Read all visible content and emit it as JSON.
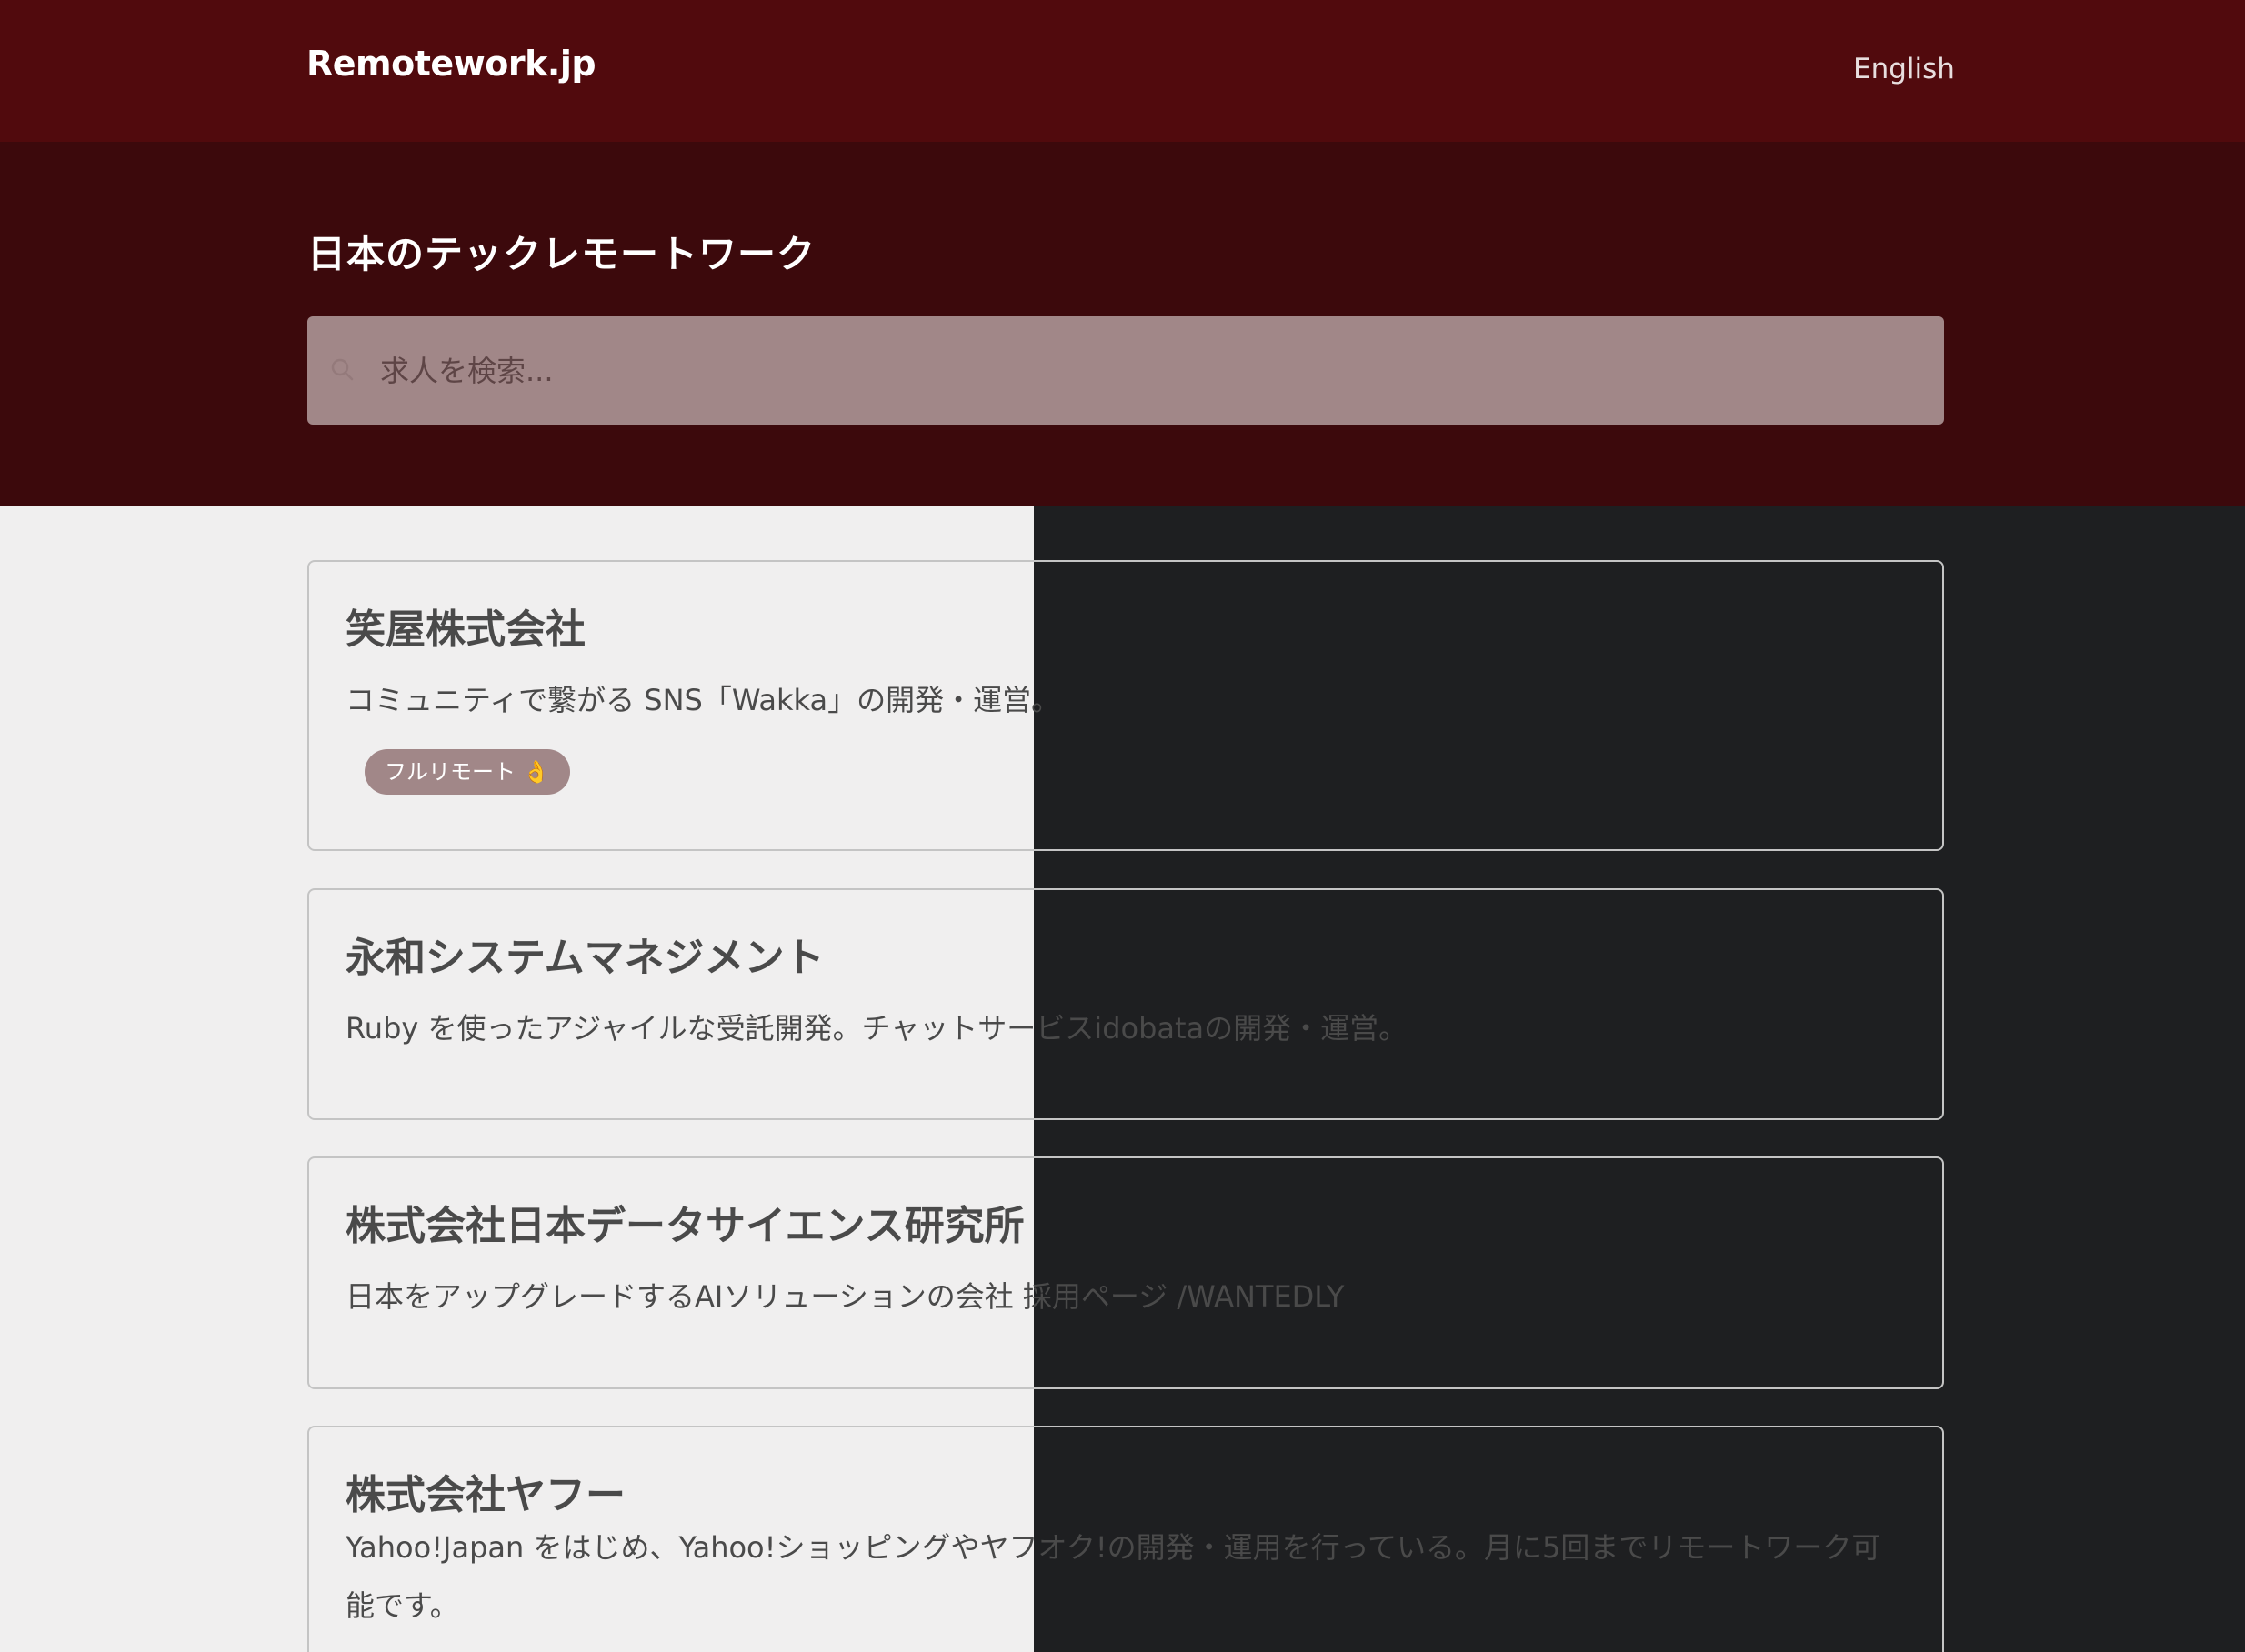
{
  "header": {
    "brand": "Remotework.jp",
    "language_link": "English"
  },
  "hero": {
    "title": "日本のテックレモートワーク",
    "search": {
      "placeholder": "求人を検索...",
      "icon": "search-icon"
    }
  },
  "jobs": [
    {
      "company": "笑屋株式会社",
      "description": "コミュニティで繋がる SNS「Wakka」の開発・運営。",
      "tag": "フルリモート 👌"
    },
    {
      "company": "永和システムマネジメント",
      "description": "Ruby を使ったアジャイルな受託開発。チャットサービスidobataの開発・運営。"
    },
    {
      "company": "株式会社日本データサイエンス研究所",
      "description": "日本をアップグレードするAIソリューションの会社 採用ページ /WANTEDLY"
    },
    {
      "company": "株式会社ヤフー",
      "description": "Yahoo!Japan をはじめ、Yahoo!ショッピングやヤフオク!の開発・運用を行っている。月に5回までリモートワーク可能です。"
    }
  ],
  "colors": {
    "nav_bg": "#510a0d",
    "hero_bg": "#3c090c",
    "search_bg": "#a18788",
    "page_bg_light": "#f0efef",
    "page_bg_dark": "#1e1f21",
    "tag_bg": "#a18788"
  }
}
